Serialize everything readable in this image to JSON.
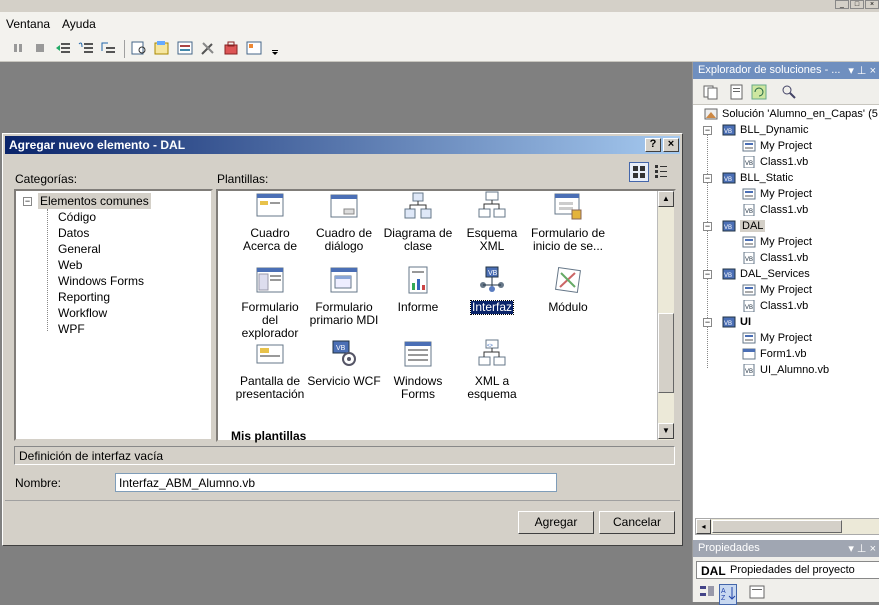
{
  "menu": {
    "items": [
      "Ventana",
      "Ayuda"
    ]
  },
  "window_buttons": [
    "_",
    "□",
    "×"
  ],
  "solution_explorer": {
    "title": "Explorador de soluciones - ...",
    "pin": "▾ p ×",
    "solution": "Solución 'Alumno_en_Capas' (5",
    "projects": [
      {
        "name": "BLL_Dynamic",
        "bold": false,
        "children": [
          "My Project",
          "Class1.vb"
        ]
      },
      {
        "name": "BLL_Static",
        "bold": false,
        "children": [
          "My Project",
          "Class1.vb"
        ]
      },
      {
        "name": "DAL",
        "bold": false,
        "selected": true,
        "children": [
          "My Project",
          "Class1.vb"
        ]
      },
      {
        "name": "DAL_Services",
        "bold": false,
        "children": [
          "My Project",
          "Class1.vb"
        ]
      },
      {
        "name": "UI",
        "bold": true,
        "children": [
          "My Project",
          "Form1.vb",
          "UI_Alumno.vb"
        ]
      }
    ]
  },
  "properties": {
    "title": "Propiedades",
    "object": "DAL",
    "object_desc": "Propiedades del proyecto"
  },
  "dialog": {
    "title": "Agregar nuevo elemento - DAL",
    "help_btn": "?",
    "close_btn": "×",
    "categories_label": "Categorías:",
    "templates_label": "Plantillas:",
    "categories_root": "Elementos comunes",
    "categories": [
      "Código",
      "Datos",
      "General",
      "Web",
      "Windows Forms",
      "Reporting",
      "Workflow",
      "WPF"
    ],
    "templates": [
      {
        "label": "Cuadro Acerca de",
        "icon": "about-box-icon"
      },
      {
        "label": "Cuadro de diálogo",
        "icon": "dialog-icon"
      },
      {
        "label": "Diagrama de clase",
        "icon": "class-diagram-icon"
      },
      {
        "label": "Esquema XML",
        "icon": "xml-schema-icon"
      },
      {
        "label": "Formulario de inicio de se...",
        "icon": "login-form-icon"
      },
      {
        "label": "Formulario del explorador",
        "icon": "explorer-form-icon"
      },
      {
        "label": "Formulario primario MDI",
        "icon": "mdi-form-icon"
      },
      {
        "label": "Informe",
        "icon": "report-icon"
      },
      {
        "label": "Interfaz",
        "icon": "interface-icon",
        "selected": true
      },
      {
        "label": "Módulo",
        "icon": "module-icon"
      },
      {
        "label": "Pantalla de presentación",
        "icon": "splash-screen-icon"
      },
      {
        "label": "Servicio WCF",
        "icon": "wcf-service-icon"
      },
      {
        "label": "Windows Forms",
        "icon": "windows-form-icon"
      },
      {
        "label": "XML a esquema",
        "icon": "xml-to-schema-icon"
      }
    ],
    "my_templates": "Mis plantillas",
    "description": "Definición de interfaz vacía",
    "name_label": "Nombre:",
    "name_value": "Interfaz_ABM_Alumno.vb",
    "add_btn": "Agregar",
    "cancel_btn": "Cancelar"
  }
}
